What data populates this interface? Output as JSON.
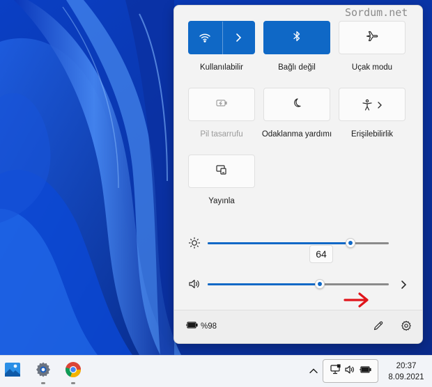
{
  "watermark": "Sordum.net",
  "tiles": [
    {
      "id": "wifi",
      "label": "Kullanılabilir",
      "icon": "wifi-icon",
      "state": "on"
    },
    {
      "id": "bluetooth",
      "label": "Bağlı değil",
      "icon": "bluetooth-icon",
      "state": "on"
    },
    {
      "id": "airplane",
      "label": "Uçak modu",
      "icon": "airplane-icon",
      "state": "off"
    },
    {
      "id": "battery-saver",
      "label": "Pil tasarrufu",
      "icon": "battery-saver-icon",
      "state": "disabled"
    },
    {
      "id": "focus",
      "label": "Odaklanma yardımı",
      "icon": "moon-icon",
      "state": "off"
    },
    {
      "id": "accessibility",
      "label": "Erişilebilirlik",
      "icon": "accessibility-icon",
      "state": "off"
    },
    {
      "id": "cast",
      "label": "Yayınla",
      "icon": "cast-icon",
      "state": "off"
    }
  ],
  "brightness": {
    "value": 64,
    "tooltip": "64",
    "icon": "brightness-icon"
  },
  "volume": {
    "value": 62,
    "icon": "speaker-icon"
  },
  "footer": {
    "battery_text": "%98",
    "battery_icon": "battery-plug-icon",
    "edit_icon": "pencil-icon",
    "settings_icon": "gear-icon"
  },
  "taskbar": {
    "apps": [
      "photos-icon",
      "settings-icon",
      "chrome-icon"
    ],
    "tray_icons": [
      "network-icon",
      "speaker-icon",
      "battery-icon"
    ],
    "time": "20:37",
    "date": "8.09.2021"
  },
  "colors": {
    "accent": "#0f68c6",
    "wallpaper": "#0b3bb8",
    "annotation_arrow": "#e0141a"
  }
}
